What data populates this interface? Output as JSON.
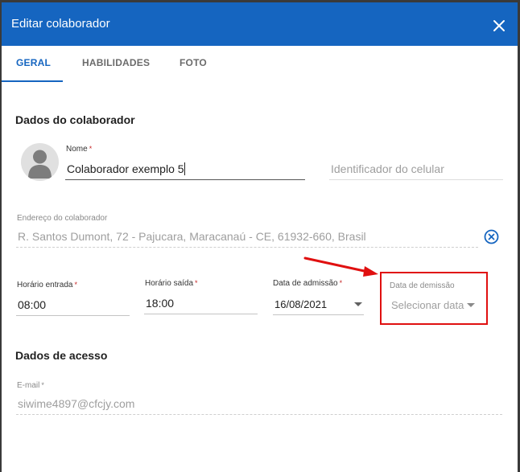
{
  "dialog": {
    "title": "Editar colaborador",
    "close_icon": "close-icon"
  },
  "tabs": [
    {
      "label": "GERAL",
      "active": true
    },
    {
      "label": "HABILIDADES",
      "active": false
    },
    {
      "label": "FOTO",
      "active": false
    }
  ],
  "sections": {
    "collaborator": "Dados do colaborador",
    "access": "Dados de acesso"
  },
  "form": {
    "name": {
      "label": "Nome",
      "required_mark": "*",
      "value": "Colaborador exemplo 5"
    },
    "device_id": {
      "placeholder": "Identificador do celular"
    },
    "address": {
      "label": "Endereço do colaborador",
      "value": "R. Santos Dumont, 72 - Pajucara, Maracanaú - CE, 61932-660, Brasil"
    },
    "entry_time": {
      "label": "Horário entrada",
      "required_mark": "*",
      "value": "08:00"
    },
    "exit_time": {
      "label": "Horário saída",
      "required_mark": "*",
      "value": "18:00"
    },
    "admission_date": {
      "label": "Data de admissão",
      "required_mark": "*",
      "value": "16/08/2021"
    },
    "dismissal_date": {
      "label": "Data de demissão",
      "placeholder": "Selecionar data"
    },
    "email": {
      "label": "E-mail",
      "required_mark": "*",
      "value": "siwime4897@cfcjy.com"
    }
  },
  "colors": {
    "primary": "#1565c0",
    "highlight": "#e01010",
    "required": "#c62828"
  }
}
